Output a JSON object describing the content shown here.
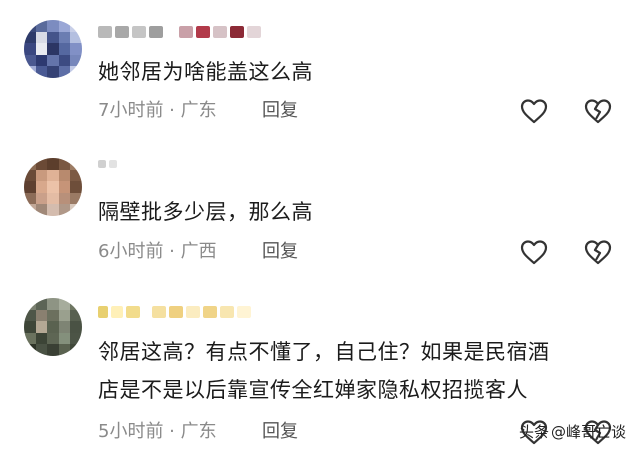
{
  "comments": [
    {
      "text": "她邻居为啥能盖这么高",
      "time_location": "7小时前 · 广东",
      "reply_label": "回复"
    },
    {
      "text": "隔壁批多少层，那么高",
      "time_location": "6小时前 · 广西",
      "reply_label": "回复"
    },
    {
      "text_line1": "邻居这高？有点不懂了，自己住？如果是民宿酒",
      "text_line2": "店是不是以后靠宣传全红婵家隐私权招揽客人",
      "time_location": "5小时前 · 广东",
      "reply_label": "回复"
    }
  ],
  "icons": {
    "like": "heart-outline-icon",
    "dislike": "broken-heart-icon"
  },
  "watermark": {
    "source": "头条",
    "handle": "@峰哥亡谈"
  },
  "colors": {
    "text": "#1b1b1b",
    "meta": "#8a8a8a",
    "reply": "#555555"
  }
}
